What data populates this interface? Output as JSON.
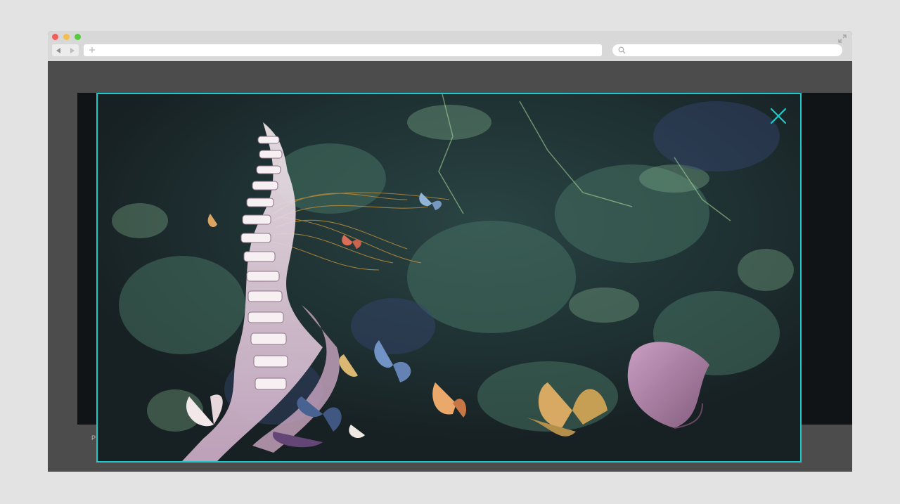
{
  "browser": {
    "back_icon": "back-arrow-icon",
    "forward_icon": "forward-arrow-icon",
    "address": "",
    "search_placeholder": "",
    "new_tab_icon": "plus-icon",
    "fullscreen_icon": "fullscreen-icon"
  },
  "page": {
    "caption": "P"
  },
  "modal": {
    "close_icon": "close-icon",
    "accent_color": "#1ec9c9",
    "image_subject": "skeleton-spine-and-butterflies-artwork"
  }
}
